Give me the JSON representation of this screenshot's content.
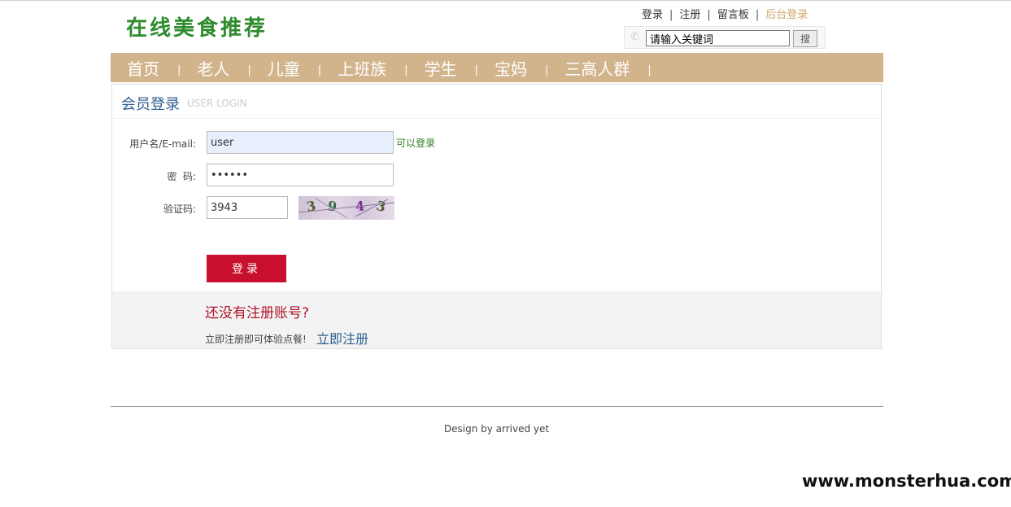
{
  "header": {
    "logo": "在线美食推荐",
    "links": [
      "登录",
      "注册",
      "留言板"
    ],
    "admin_link": "后台登录",
    "search": {
      "value": "请输入关键词",
      "button": "搜"
    }
  },
  "nav": {
    "items": [
      "首页",
      "老人",
      "儿童",
      "上班族",
      "学生",
      "宝妈",
      "三高人群"
    ]
  },
  "login": {
    "title": "会员登录",
    "subtitle": "USER LOGIN",
    "username_label": "用户名/E-mail:",
    "username_value": "user",
    "username_hint": "可以登录",
    "password_label": "密  码:",
    "password_value": "••••••",
    "captcha_label": "验证码:",
    "captcha_value": "3943",
    "captcha_image_chars": [
      "3",
      "9",
      "4",
      "3"
    ],
    "submit": "登录"
  },
  "register": {
    "question": "还没有注册账号?",
    "text": "立即注册即可体验点餐!",
    "link": "立即注册"
  },
  "footer": {
    "text": "Design by arrived yet"
  },
  "watermark": "www.monsterhua.com",
  "colors": {
    "nav_bg": "#d2b48c",
    "accent_red": "#c8102e",
    "logo_green": "#2e8b2e",
    "title_blue": "#2c5f8e"
  }
}
